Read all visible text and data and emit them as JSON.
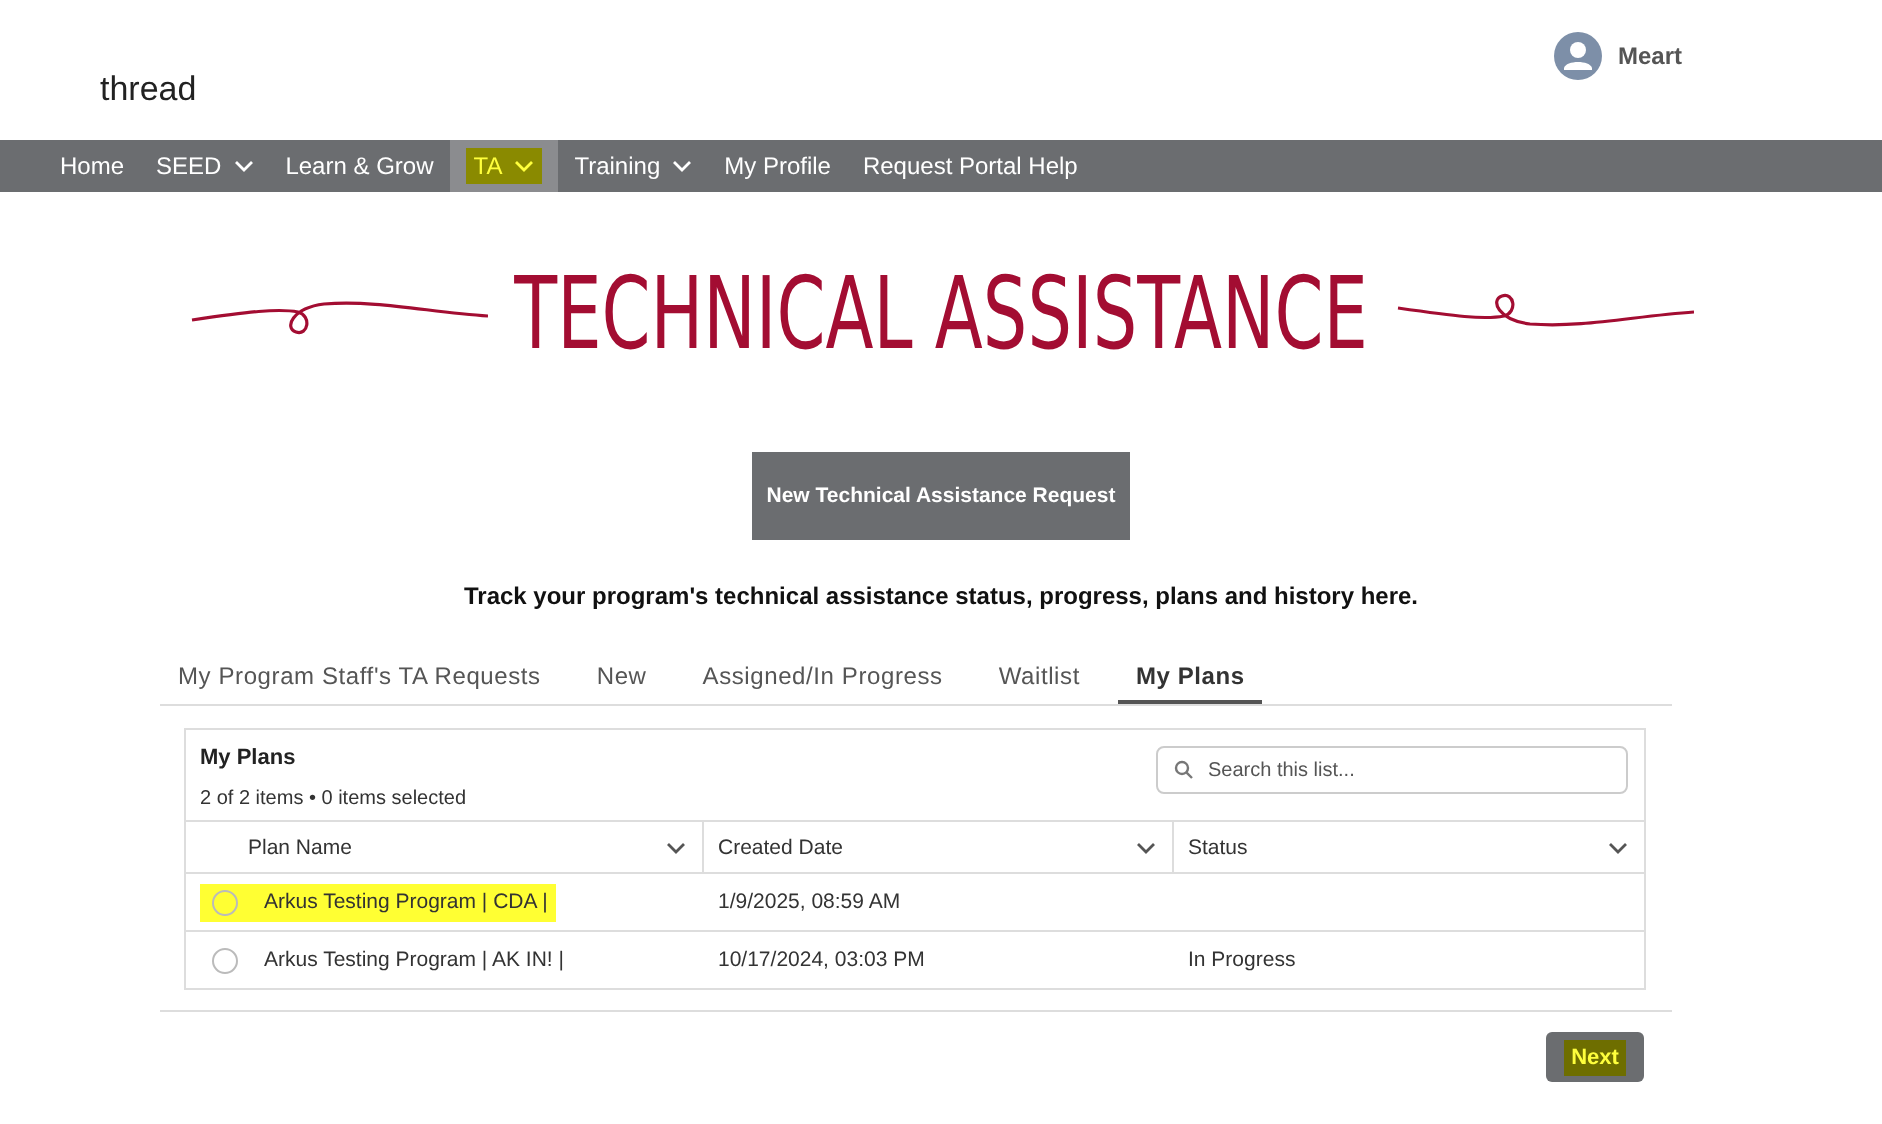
{
  "header": {
    "logo": "thread",
    "user": "Meart"
  },
  "nav": [
    {
      "label": "Home",
      "dropdown": false,
      "selected": false
    },
    {
      "label": "SEED",
      "dropdown": true,
      "selected": false
    },
    {
      "label": "Learn & Grow",
      "dropdown": false,
      "selected": false
    },
    {
      "label": "TA",
      "dropdown": true,
      "selected": true
    },
    {
      "label": "Training",
      "dropdown": true,
      "selected": false
    },
    {
      "label": "My Profile",
      "dropdown": false,
      "selected": false
    },
    {
      "label": "Request Portal Help",
      "dropdown": false,
      "selected": false
    }
  ],
  "title": "TECHNICAL ASSISTANCE",
  "new_request_button": "New Technical Assistance Request",
  "subtitle": "Track your program's technical assistance status, progress, plans and history here.",
  "tabs": [
    {
      "label": "My Program Staff's TA Requests",
      "selected": false
    },
    {
      "label": "New",
      "selected": false
    },
    {
      "label": "Assigned/In Progress",
      "selected": false
    },
    {
      "label": "Waitlist",
      "selected": false
    },
    {
      "label": "My Plans",
      "selected": true
    }
  ],
  "list": {
    "title": "My Plans",
    "summary": "2 of 2 items • 0 items selected",
    "search": {
      "placeholder": "Search this list..."
    },
    "columns": [
      "Plan Name",
      "Created Date",
      "Status"
    ],
    "rows": [
      {
        "cells": [
          "Arkus Testing Program | CDA |",
          "1/9/2025, 08:59 AM",
          ""
        ],
        "selected": false,
        "highlighted": true
      },
      {
        "cells": [
          "Arkus Testing Program | AK IN! |",
          "10/17/2024, 03:03 PM",
          "In Progress"
        ],
        "selected": false,
        "highlighted": false
      }
    ]
  },
  "next_button": {
    "label": "Next",
    "highlighted": true
  }
}
